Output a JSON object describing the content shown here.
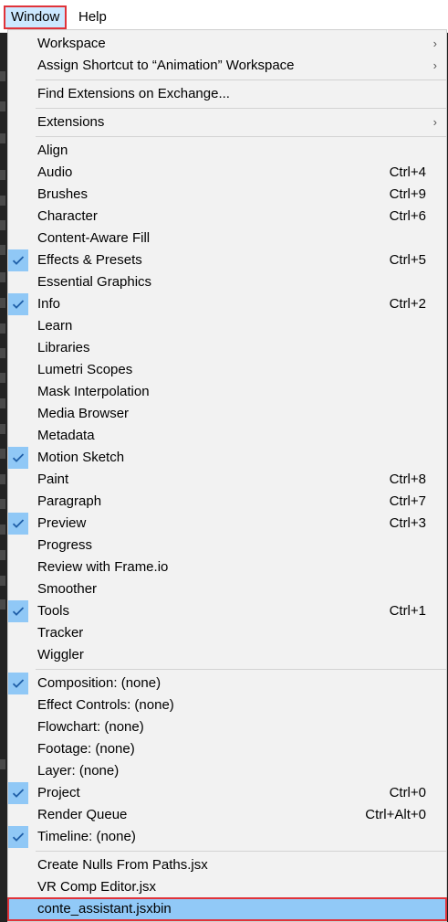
{
  "menubar": {
    "window_label": "Window",
    "help_label": "Help"
  },
  "menu": {
    "items": [
      {
        "label": "Workspace",
        "shortcut": "",
        "checked": false,
        "submenu": true
      },
      {
        "label": "Assign Shortcut to “Animation” Workspace",
        "shortcut": "",
        "checked": false,
        "submenu": true
      },
      {
        "separator": true
      },
      {
        "label": "Find Extensions on Exchange...",
        "shortcut": "",
        "checked": false,
        "submenu": false
      },
      {
        "separator": true
      },
      {
        "label": "Extensions",
        "shortcut": "",
        "checked": false,
        "submenu": true
      },
      {
        "separator": true
      },
      {
        "label": "Align",
        "shortcut": "",
        "checked": false
      },
      {
        "label": "Audio",
        "shortcut": "Ctrl+4",
        "checked": false
      },
      {
        "label": "Brushes",
        "shortcut": "Ctrl+9",
        "checked": false
      },
      {
        "label": "Character",
        "shortcut": "Ctrl+6",
        "checked": false
      },
      {
        "label": "Content-Aware Fill",
        "shortcut": "",
        "checked": false
      },
      {
        "label": "Effects & Presets",
        "shortcut": "Ctrl+5",
        "checked": true
      },
      {
        "label": "Essential Graphics",
        "shortcut": "",
        "checked": false
      },
      {
        "label": "Info",
        "shortcut": "Ctrl+2",
        "checked": true
      },
      {
        "label": "Learn",
        "shortcut": "",
        "checked": false
      },
      {
        "label": "Libraries",
        "shortcut": "",
        "checked": false
      },
      {
        "label": "Lumetri Scopes",
        "shortcut": "",
        "checked": false
      },
      {
        "label": "Mask Interpolation",
        "shortcut": "",
        "checked": false
      },
      {
        "label": "Media Browser",
        "shortcut": "",
        "checked": false
      },
      {
        "label": "Metadata",
        "shortcut": "",
        "checked": false
      },
      {
        "label": "Motion Sketch",
        "shortcut": "",
        "checked": true
      },
      {
        "label": "Paint",
        "shortcut": "Ctrl+8",
        "checked": false
      },
      {
        "label": "Paragraph",
        "shortcut": "Ctrl+7",
        "checked": false
      },
      {
        "label": "Preview",
        "shortcut": "Ctrl+3",
        "checked": true
      },
      {
        "label": "Progress",
        "shortcut": "",
        "checked": false
      },
      {
        "label": "Review with Frame.io",
        "shortcut": "",
        "checked": false
      },
      {
        "label": "Smoother",
        "shortcut": "",
        "checked": false
      },
      {
        "label": "Tools",
        "shortcut": "Ctrl+1",
        "checked": true
      },
      {
        "label": "Tracker",
        "shortcut": "",
        "checked": false
      },
      {
        "label": "Wiggler",
        "shortcut": "",
        "checked": false
      },
      {
        "separator": true
      },
      {
        "label": "Composition: (none)",
        "shortcut": "",
        "checked": true
      },
      {
        "label": "Effect Controls: (none)",
        "shortcut": "",
        "checked": false
      },
      {
        "label": "Flowchart: (none)",
        "shortcut": "",
        "checked": false
      },
      {
        "label": "Footage: (none)",
        "shortcut": "",
        "checked": false
      },
      {
        "label": "Layer: (none)",
        "shortcut": "",
        "checked": false
      },
      {
        "label": "Project",
        "shortcut": "Ctrl+0",
        "checked": true
      },
      {
        "label": "Render Queue",
        "shortcut": "Ctrl+Alt+0",
        "checked": false
      },
      {
        "label": "Timeline: (none)",
        "shortcut": "",
        "checked": true
      },
      {
        "separator": true
      },
      {
        "label": "Create Nulls From Paths.jsx",
        "shortcut": "",
        "checked": false
      },
      {
        "label": "VR Comp Editor.jsx",
        "shortcut": "",
        "checked": false
      },
      {
        "label": "conte_assistant.jsxbin",
        "shortcut": "",
        "checked": false,
        "highlighted": true
      }
    ]
  },
  "colors": {
    "highlight": "#91c9f7",
    "check_bg": "#90c8f6",
    "accent_border": "#e0333a",
    "menu_bg": "#f2f2f2"
  }
}
